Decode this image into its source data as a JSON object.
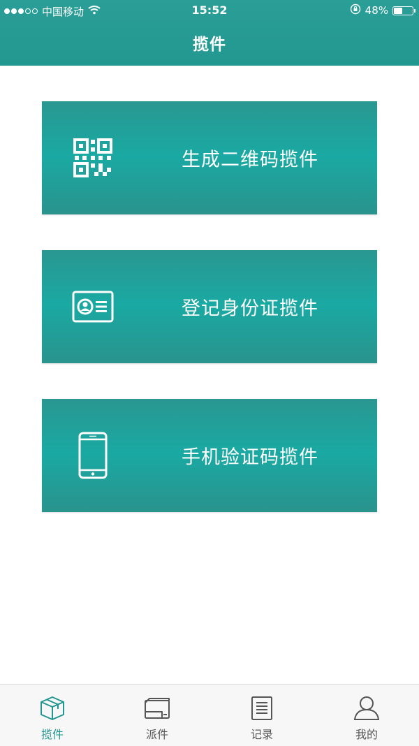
{
  "status_bar": {
    "carrier": "中国移动",
    "time": "15:52",
    "battery": "48%",
    "battery_level": 0.48
  },
  "header": {
    "title": "揽件"
  },
  "cards": [
    {
      "label": "生成二维码揽件",
      "icon": "qr-code-icon"
    },
    {
      "label": "登记身份证揽件",
      "icon": "id-card-icon"
    },
    {
      "label": "手机验证码揽件",
      "icon": "mobile-phone-icon"
    }
  ],
  "tabbar": {
    "active_index": 0,
    "active_color": "#22968f",
    "inactive_color": "#555555",
    "items": [
      {
        "label": "揽件",
        "icon": "package-box-icon"
      },
      {
        "label": "派件",
        "icon": "delivery-tray-icon"
      },
      {
        "label": "记录",
        "icon": "record-list-icon"
      },
      {
        "label": "我的",
        "icon": "user-profile-icon"
      }
    ]
  },
  "colors": {
    "primary": "#229890",
    "card_gradient_mid": "#1aa9a3"
  }
}
